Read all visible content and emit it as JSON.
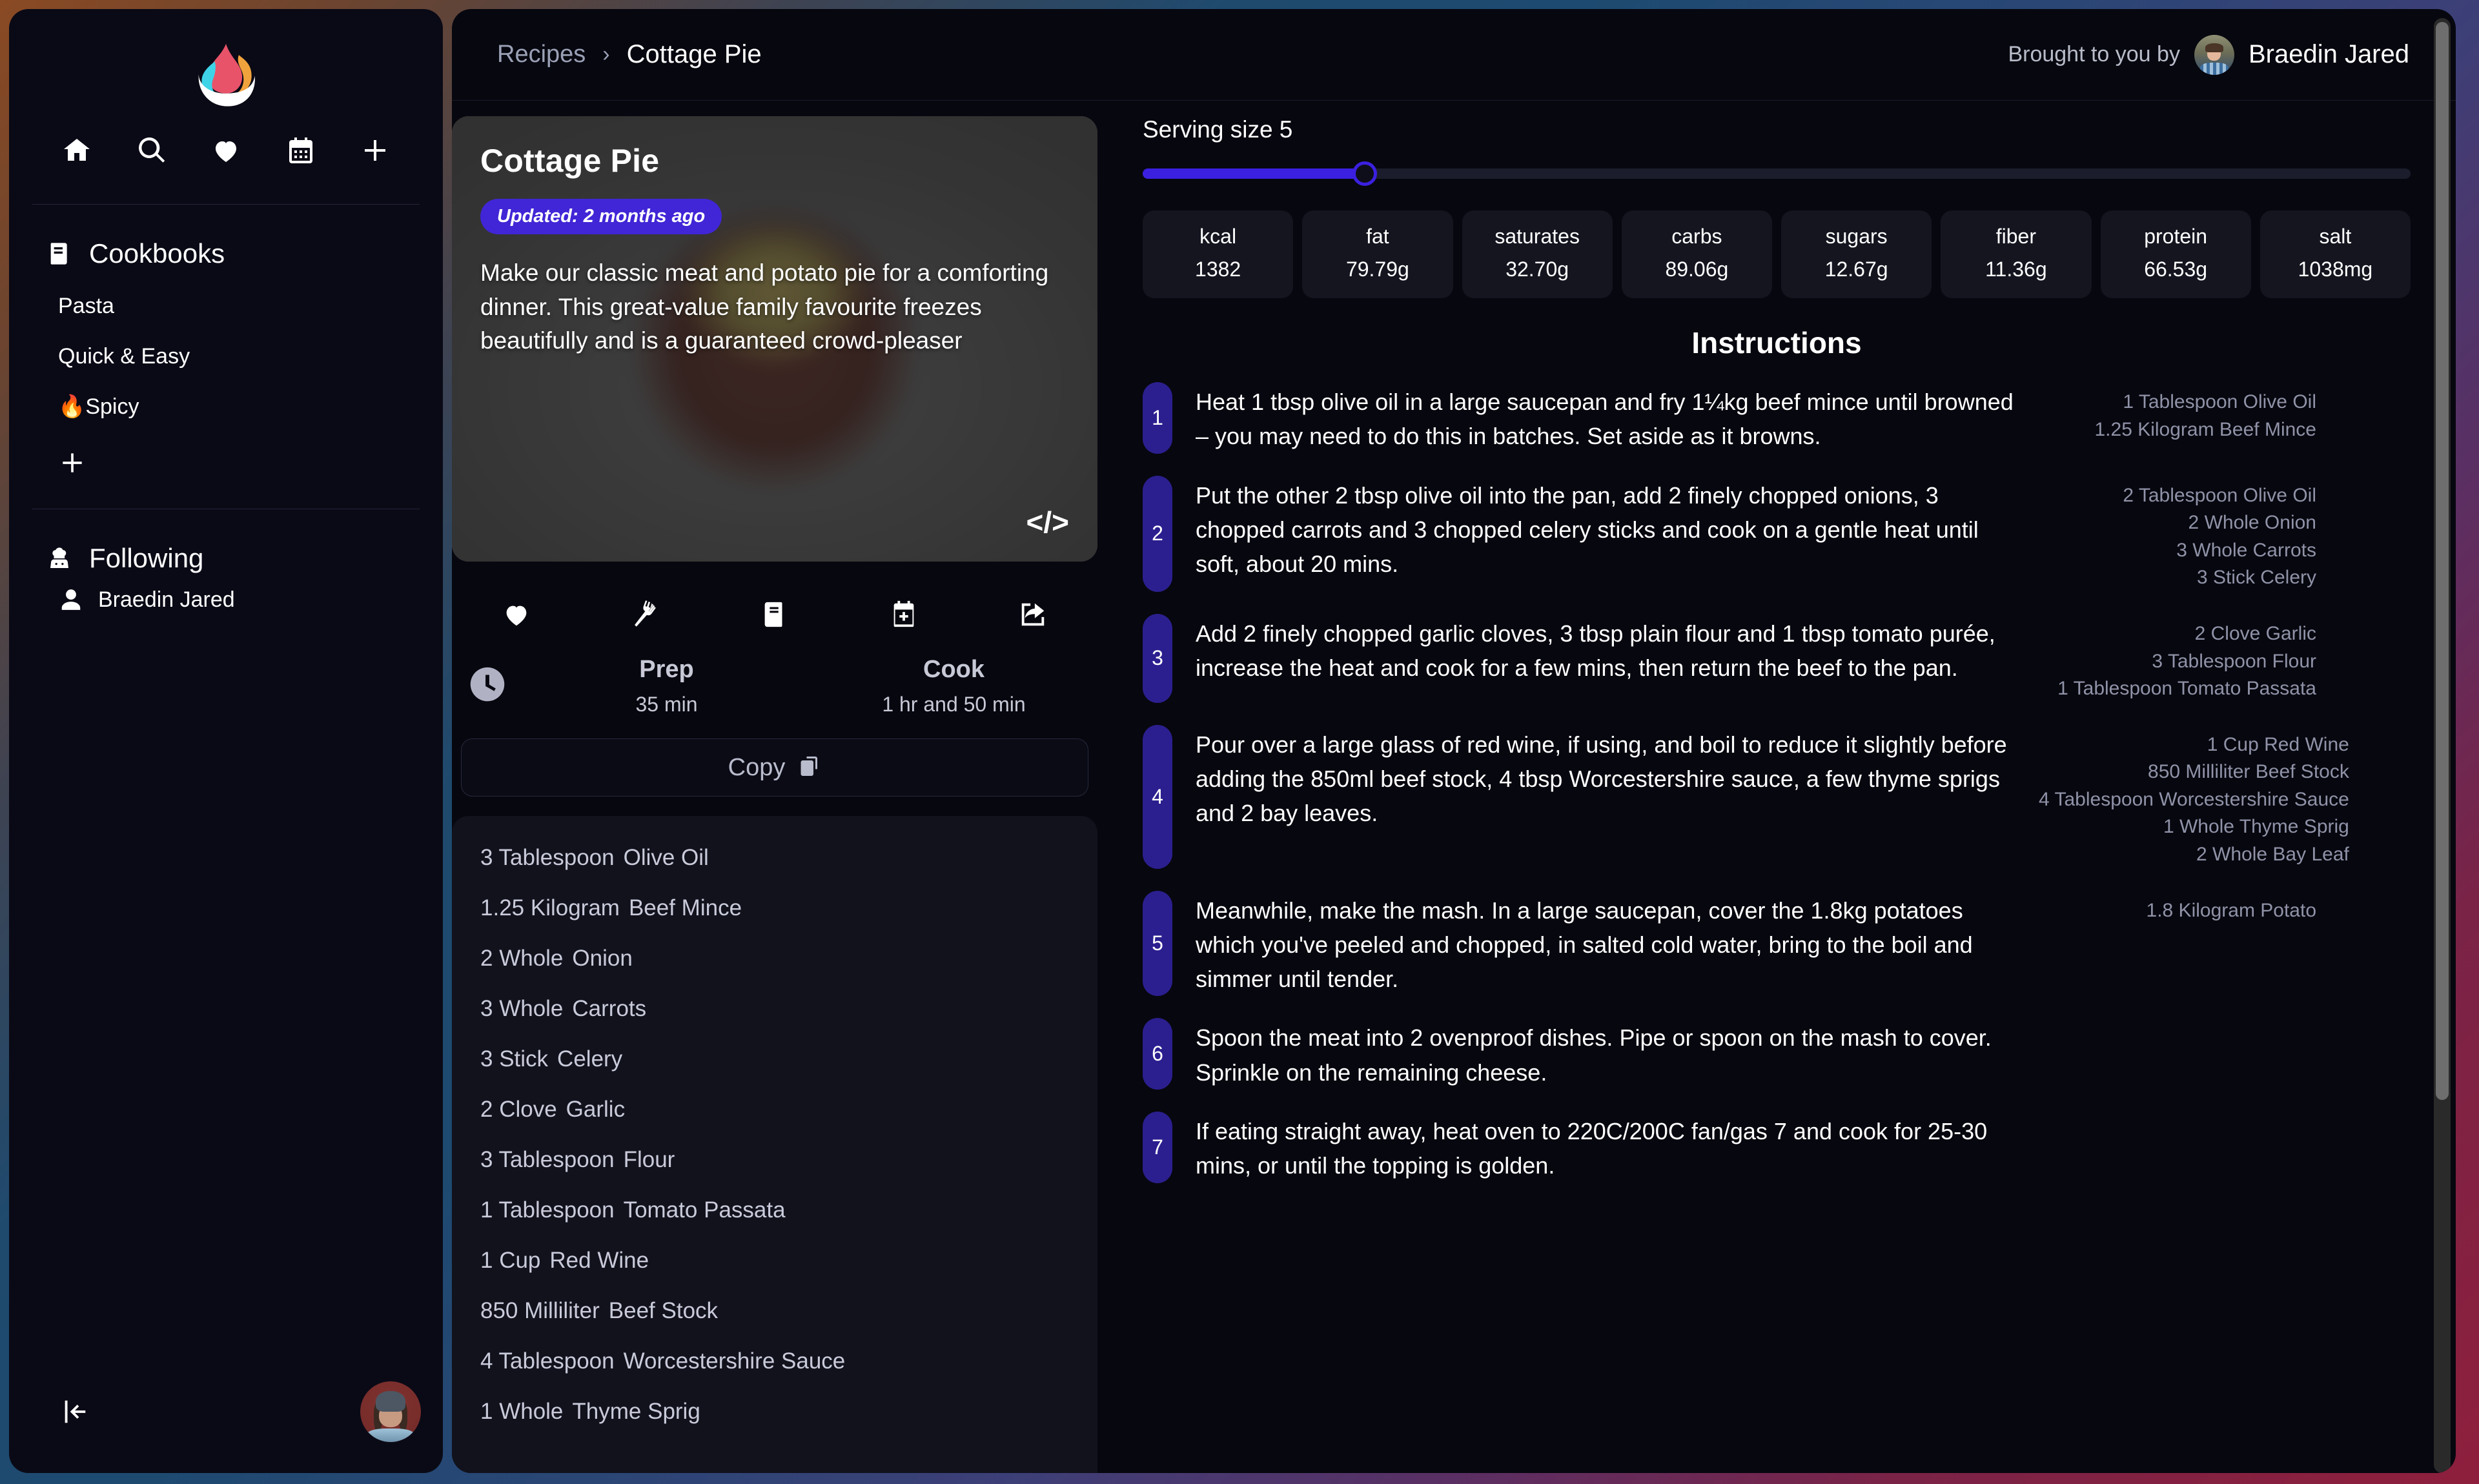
{
  "app": {
    "logo_name": "flame-logo"
  },
  "sidebar": {
    "nav_icons": [
      "home-icon",
      "search-icon",
      "heart-icon",
      "calendar-icon",
      "plus-icon"
    ],
    "cookbooks": {
      "heading": "Cookbooks",
      "heading_icon": "book-icon",
      "items": [
        {
          "label": "Pasta"
        },
        {
          "label": "Quick & Easy"
        },
        {
          "label": "🔥Spicy"
        }
      ],
      "add_icon": "plus-icon"
    },
    "following": {
      "heading": "Following",
      "heading_icon": "chef-icon",
      "items": [
        {
          "label": "Braedin Jared",
          "icon": "person-icon"
        }
      ]
    },
    "collapse_icon": "collapse-sidebar-icon",
    "avatar_name": "user-avatar"
  },
  "header": {
    "breadcrumb_root": "Recipes",
    "breadcrumb_sep": "›",
    "breadcrumb_current": "Cottage Pie",
    "brought_label": "Brought to you by",
    "author": "Braedin Jared"
  },
  "recipe": {
    "title": "Cottage Pie",
    "updated_badge": "Updated: 2 months ago",
    "description": "Make our classic meat and potato pie for a comforting dinner. This great-value family favourite freezes beautifully and is a guaranteed crowd-pleaser",
    "code_icon": "</>",
    "actions": [
      "heart-icon",
      "fork-icon",
      "cookbook-icon",
      "calendar-add-icon",
      "share-icon"
    ],
    "prep_label": "Prep",
    "prep_value": "35 min",
    "cook_label": "Cook",
    "cook_value": "1 hr and 50 min",
    "copy_label": "Copy",
    "copy_icon": "copy-icon",
    "ingredients": [
      {
        "qty": "3 Tablespoon",
        "name": "Olive Oil"
      },
      {
        "qty": "1.25 Kilogram",
        "name": "Beef Mince"
      },
      {
        "qty": "2 Whole",
        "name": "Onion"
      },
      {
        "qty": "3 Whole",
        "name": "Carrots"
      },
      {
        "qty": "3 Stick",
        "name": "Celery"
      },
      {
        "qty": "2 Clove",
        "name": "Garlic"
      },
      {
        "qty": "3 Tablespoon",
        "name": "Flour"
      },
      {
        "qty": "1 Tablespoon",
        "name": "Tomato Passata"
      },
      {
        "qty": "1 Cup",
        "name": "Red Wine"
      },
      {
        "qty": "850 Milliliter",
        "name": "Beef Stock"
      },
      {
        "qty": "4 Tablespoon",
        "name": "Worcestershire Sauce"
      },
      {
        "qty": "1 Whole",
        "name": "Thyme Sprig"
      }
    ]
  },
  "serving": {
    "label": "Serving size 5",
    "value": 5,
    "fill_percent": 17.5
  },
  "nutrition": [
    {
      "label": "kcal",
      "value": "1382"
    },
    {
      "label": "fat",
      "value": "79.79g"
    },
    {
      "label": "saturates",
      "value": "32.70g"
    },
    {
      "label": "carbs",
      "value": "89.06g"
    },
    {
      "label": "sugars",
      "value": "12.67g"
    },
    {
      "label": "fiber",
      "value": "11.36g"
    },
    {
      "label": "protein",
      "value": "66.53g"
    },
    {
      "label": "salt",
      "value": "1038mg"
    }
  ],
  "instructions": {
    "title": "Instructions",
    "steps": [
      {
        "num": "1",
        "text": "Heat 1 tbsp olive oil in a large saucepan and fry 1¼kg beef mince until browned – you may need to do this in batches. Set aside as it browns.",
        "ingredients": [
          "1 Tablespoon Olive Oil",
          "1.25 Kilogram Beef Mince"
        ]
      },
      {
        "num": "2",
        "text": "Put the other 2 tbsp olive oil into the pan, add 2 finely chopped onions, 3 chopped carrots and 3 chopped celery sticks and cook on a gentle heat until soft, about 20 mins.",
        "ingredients": [
          "2 Tablespoon Olive Oil",
          "2 Whole Onion",
          "3 Whole Carrots",
          "3 Stick Celery"
        ]
      },
      {
        "num": "3",
        "text": "Add 2 finely chopped garlic cloves, 3 tbsp plain flour and 1 tbsp tomato purée, increase the heat and cook for a few mins, then return the beef to the pan.",
        "ingredients": [
          "2 Clove Garlic",
          "3 Tablespoon Flour",
          "1 Tablespoon Tomato Passata"
        ]
      },
      {
        "num": "4",
        "text": "Pour over a large glass of red wine, if using, and boil to reduce it slightly before adding the 850ml beef stock, 4 tbsp Worcestershire sauce, a few thyme sprigs and 2 bay leaves.",
        "ingredients": [
          "1 Cup Red Wine",
          "850 Milliliter Beef Stock",
          "4 Tablespoon Worcestershire Sauce",
          "1 Whole Thyme Sprig",
          "2 Whole Bay Leaf"
        ]
      },
      {
        "num": "5",
        "text": "Meanwhile, make the mash. In a large saucepan, cover the 1.8kg potatoes which you've peeled and chopped, in salted cold water, bring to the boil and simmer until tender.",
        "ingredients": [
          "1.8 Kilogram Potato"
        ]
      },
      {
        "num": "6",
        "text": "Spoon the meat into 2 ovenproof dishes. Pipe or spoon on the mash to cover. Sprinkle on the remaining cheese.",
        "ingredients": []
      },
      {
        "num": "7",
        "text": "If eating straight away, heat oven to 220C/200C fan/gas 7 and cook for 25-30 mins, or until the topping is golden.",
        "ingredients": []
      }
    ]
  },
  "colors": {
    "accent": "#3b20e0",
    "badge": "#4026d6",
    "step_num": "#2b1f8f",
    "panel": "#11121c",
    "app_bg": "#07070f"
  }
}
